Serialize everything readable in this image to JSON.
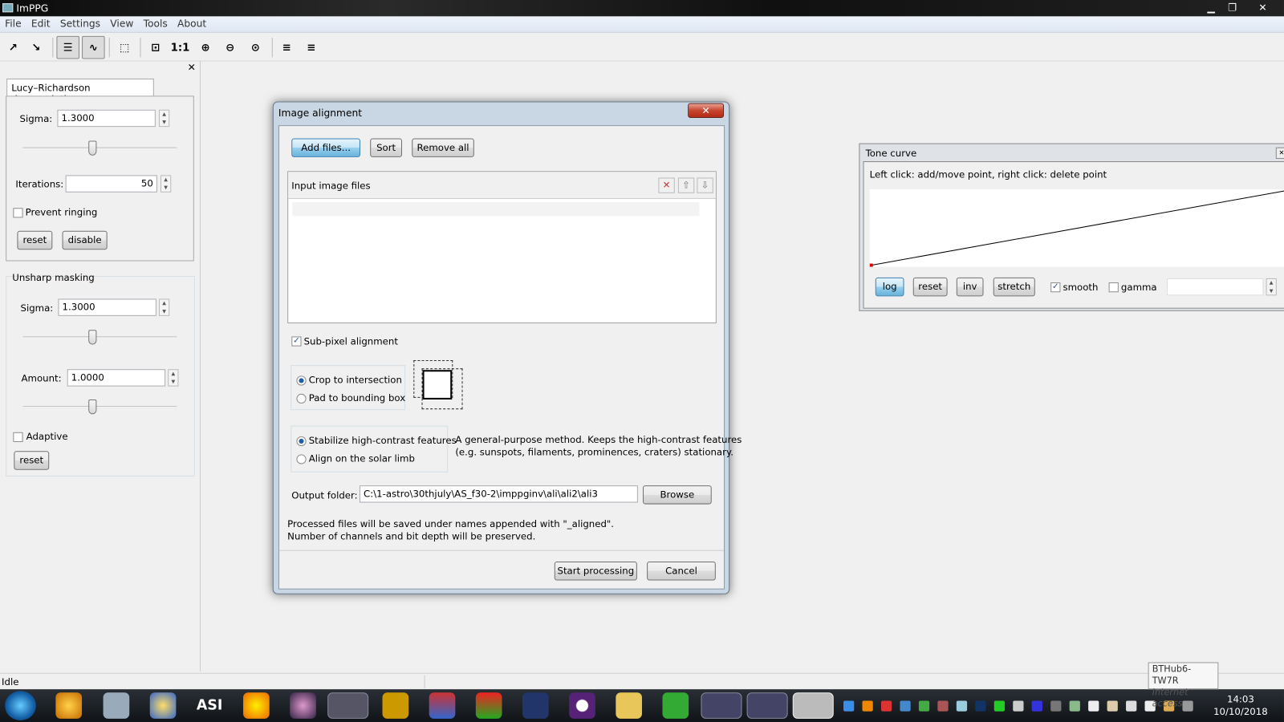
{
  "app": {
    "title": "ImPPG"
  },
  "menu": [
    "File",
    "Edit",
    "Settings",
    "View",
    "Tools",
    "About"
  ],
  "toolbar": {
    "icons": [
      "load-image-icon",
      "save-image-icon",
      "toggle-panel-icon",
      "tone-curve-icon",
      "select-region-icon",
      "fit-window-icon",
      "zoom-reset-icon",
      "zoom-in-icon",
      "zoom-out-icon",
      "zoom-custom-icon",
      "save-settings-icon",
      "load-settings-icon"
    ],
    "zoom_reset_label": "1:1"
  },
  "lucy": {
    "tab": "Lucy–Richardson deconvolution",
    "sigma_label": "Sigma:",
    "sigma": "1.3000",
    "sigma_slider": 0.45,
    "iterations_label": "Iterations:",
    "iterations": "50",
    "prevent_ringing": "Prevent ringing",
    "prevent_ringing_checked": false,
    "reset": "reset",
    "disable": "disable"
  },
  "unsharp": {
    "title": "Unsharp masking",
    "sigma_label": "Sigma:",
    "sigma": "1.3000",
    "sigma_slider": 0.45,
    "amount_label": "Amount:",
    "amount": "1.0000",
    "amount_slider": 0.45,
    "adaptive": "Adaptive",
    "adaptive_checked": false,
    "reset": "reset"
  },
  "dialog": {
    "title": "Image alignment",
    "add_files": "Add files...",
    "sort": "Sort",
    "remove_all": "Remove all",
    "list_header": "Input image files",
    "files": [],
    "subpixel": "Sub-pixel alignment",
    "subpixel_checked": true,
    "crop": "Crop to intersection",
    "pad": "Pad to bounding box",
    "crop_selected": "crop",
    "stabilize": "Stabilize high-contrast features",
    "limb": "Align on the solar limb",
    "method_selected": "stabilize",
    "method_desc1": "A general-purpose method. Keeps the high-contrast features",
    "method_desc2": "(e.g. sunspots, filaments, prominences, craters) stationary.",
    "output_label": "Output folder:",
    "output_value": "C:\\1-astro\\30thjuly\\AS_f30-2\\imppginv\\ali\\ali2\\ali3",
    "browse": "Browse",
    "note1": "Processed files will be saved under names appended with \"_aligned\".",
    "note2": "Number of channels and bit depth will be preserved.",
    "start": "Start processing",
    "cancel": "Cancel"
  },
  "tone": {
    "title": "Tone curve",
    "hint": "Left click: add/move point, right click: delete point",
    "curve_points": [
      [
        0,
        0
      ],
      [
        1,
        1
      ]
    ],
    "log": "log",
    "reset": "reset",
    "inv": "inv",
    "stretch": "stretch",
    "smooth": "smooth",
    "smooth_checked": true,
    "gamma": "gamma",
    "gamma_checked": false,
    "gamma_value": ""
  },
  "status": {
    "text": "Idle"
  },
  "tooltip": {
    "network": "BTHub6-TW7R",
    "access": "Internet access"
  },
  "clock": {
    "time": "14:03",
    "date": "10/10/2018"
  },
  "colors": {
    "default_button": "#98d1ef",
    "close_button": "#c7452f",
    "curve_start_point": "#e00000"
  }
}
